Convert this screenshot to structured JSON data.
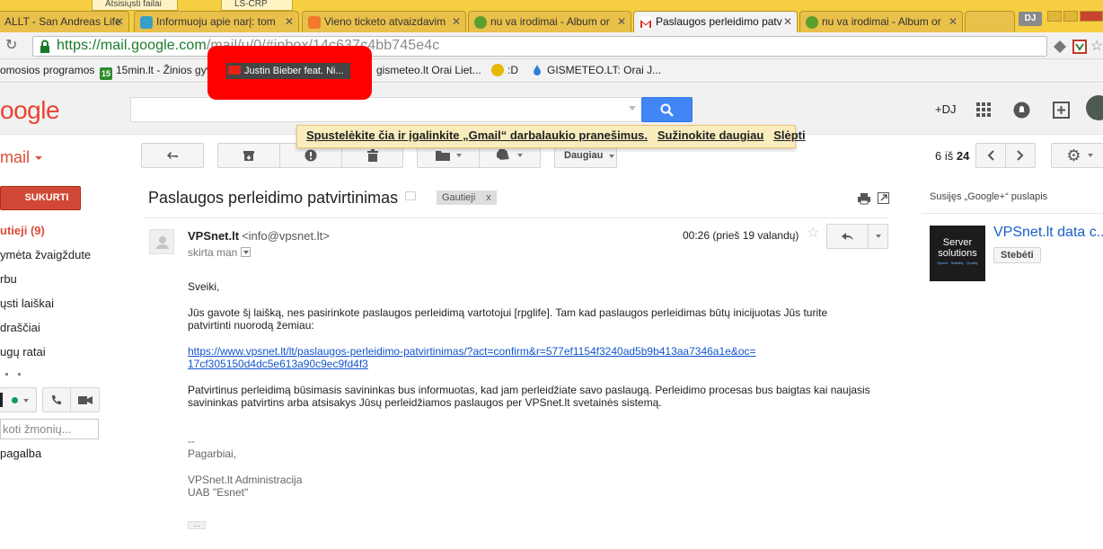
{
  "browser": {
    "ghost_tabs": [
      "Atsisiųsti failai",
      "LS-CRP"
    ],
    "tabs": [
      {
        "label": "ALLT - San Andreas Life",
        "active": false
      },
      {
        "label": "Informuoju apie narį: tom",
        "active": false
      },
      {
        "label": "Vieno ticketo atvaizdavim",
        "active": false
      },
      {
        "label": "nu va irodimai - Album or",
        "active": false
      },
      {
        "label": "Paslaugos perleidimo patv",
        "active": true
      },
      {
        "label": "nu va irodimai - Album or",
        "active": false
      }
    ],
    "profile_badge": "DJ",
    "url_main": "https://mail.google.com",
    "url_faded": "/mail/u/0/#inbox/14c637c4bb745e4c",
    "bookmarks": [
      "omosios programos",
      "15min.lt - Žinios gyv",
      "Justin Bieber feat. Ni...",
      "gismeteo.lt Orai Liet...",
      ":D",
      "GISMETEO.LT: Orai J..."
    ],
    "bookmark_badge": "15"
  },
  "header": {
    "logo": "oogle",
    "user": "+DJ"
  },
  "notice": {
    "text": "Spustelėkite čia ir įgalinkite „Gmail“ darbalaukio pranešimus.",
    "learn_more": "Sužinokite daugiau",
    "hide": "Slėpti"
  },
  "toolbar": {
    "gmail_label": "mail",
    "more_label": "Daugiau",
    "pager_prefix": "6 iš",
    "pager_total": "24"
  },
  "sidebar": {
    "compose": "SUKURTI",
    "items": [
      {
        "label": "utieji (9)",
        "active": true
      },
      {
        "label": "ymėta žvaigždute",
        "active": false
      },
      {
        "label": "rbu",
        "active": false
      },
      {
        "label": "ųsti laiškai",
        "active": false
      },
      {
        "label": "draščiai",
        "active": false
      },
      {
        "label": "ugų ratai",
        "active": false
      }
    ],
    "people_search_placeholder": "koti žmonių...",
    "help": "pagalba"
  },
  "message": {
    "subject": "Paslaugos perleidimo patvirtinimas",
    "label_chip": "Gautieji",
    "label_chip_close": "x",
    "sender_name": "VPSnet.lt",
    "sender_email": "<info@vpsnet.lt>",
    "to_me": "skirta man",
    "time": "00:26 (prieš 19 valandų)",
    "greeting": "Sveiki,",
    "para1": "Jūs gavote šį laišką, nes pasirinkote paslaugos perleidimą vartotojui [rpglife]. Tam kad paslaugos perleidimas būtų inicijuotas Jūs turite patvirtinti nuorodą žemiau:",
    "link_line1": "https://www.vpsnet.lt/lt/paslaugos-perleidimo-patvirtinimas/?act=confirm&r=577ef1154f3240ad5b9b413aa7346a1e&oc=",
    "link_line2": "17cf305150d4dc5e613a90c9ec9fd4f3",
    "para2": "Patvirtinus perleidimą būsimasis savininkas bus informuotas, kad jam perleidžiate savo paslaugą. Perleidimo procesas bus baigtas kai naujasis savininkas patvirtins arba atsisakys Jūsų perleidžiamos paslaugos per VPSnet.lt svetainės sistemą.",
    "sig_dashes": "--",
    "sig_regards": "Pagarbiai,",
    "sig_admin": "VPSnet.lt Administracija",
    "sig_company": "UAB \"Esnet\""
  },
  "right_panel": {
    "title": "Susijęs „Google+“ puslapis",
    "name": "VPSnet.lt data c...",
    "follow": "Stebėti",
    "image_line1": "Server",
    "image_line2": "solutions",
    "image_line3": "Speed · Stability · Quality"
  },
  "colors": {
    "tabstrip": "#f5ce41",
    "url_green": "#1a7a2a",
    "compose_red": "#d14836",
    "search_blue": "#4285f4",
    "link_blue": "#1155cc",
    "notice_bg": "#f9edbe",
    "highlight_red": "#ff0000"
  }
}
